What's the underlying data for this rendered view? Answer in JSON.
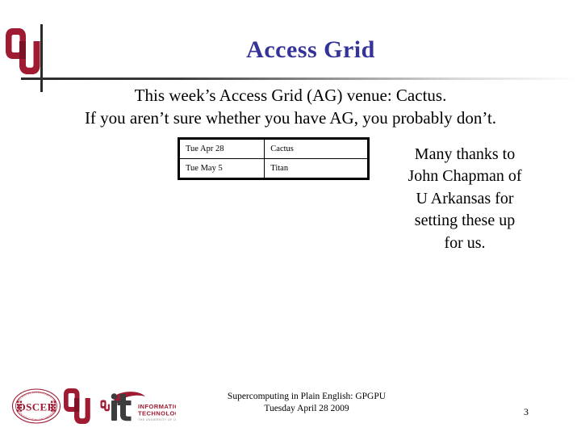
{
  "slide": {
    "title": "Access Grid",
    "title_color": "#333399",
    "subtitle_lines": [
      "This week’s Access Grid (AG) venue: Cactus.",
      "If you aren’t sure whether you have AG, you probably don’t."
    ],
    "thanks_lines": [
      "Many thanks to",
      "John Chapman of",
      "U Arkansas for",
      "setting these up",
      "for us."
    ]
  },
  "schedule_table": {
    "rows": [
      {
        "date": "Tue Apr 28",
        "venue": "Cactus"
      },
      {
        "date": "Tue May 5",
        "venue": "Titan"
      }
    ]
  },
  "footer": {
    "line1": "Supercomputing in Plain English: GPGPU",
    "line2": "Tuesday April 28 2009",
    "page_number": "3"
  },
  "logos": {
    "ou_top": "ou-logo",
    "oscer": "oscer-seal-logo",
    "ou_bottom": "ou-logo",
    "it": {
      "name": "ou-information-technology-logo",
      "mark": "it",
      "line1": "INFORMATION",
      "line2": "TECHNOLOGY",
      "line3": "THE UNIVERSITY OF OKLAHOMA"
    }
  },
  "colors": {
    "crimson": "#9e1b32",
    "crimson_dark": "#7b1226",
    "navy": "#333399",
    "rule": "#2b2b2b"
  }
}
